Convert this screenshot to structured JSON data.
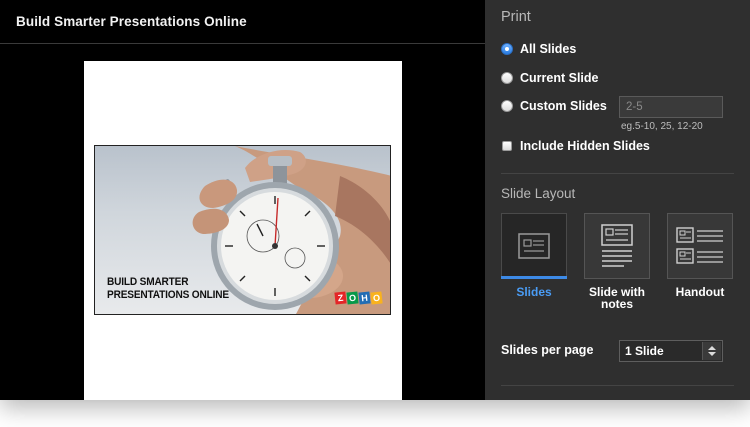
{
  "preview": {
    "title": "Build Smarter Presentations Online",
    "slide_caption_line1": "BUILD SMARTER",
    "slide_caption_line2": "PRESENTATIONS ONLINE",
    "logo_letters": [
      "Z",
      "O",
      "H",
      "O"
    ],
    "logo_colors": [
      "#e42527",
      "#089949",
      "#226db4",
      "#f9b21d"
    ]
  },
  "print": {
    "title": "Print",
    "options": [
      {
        "label": "All Slides",
        "checked": true
      },
      {
        "label": "Current Slide",
        "checked": false
      },
      {
        "label": "Custom Slides",
        "checked": false
      }
    ],
    "custom_placeholder": "2-5",
    "custom_hint": "eg.5-10, 25, 12-20",
    "include_hidden_label": "Include Hidden Slides"
  },
  "layout": {
    "title": "Slide Layout",
    "options": [
      {
        "label": "Slides",
        "selected": true,
        "icon": "slides-layout-icon"
      },
      {
        "label": "Slide with notes",
        "selected": false,
        "icon": "slide-notes-layout-icon"
      },
      {
        "label": "Handout",
        "selected": false,
        "icon": "handout-layout-icon"
      }
    ]
  },
  "per_page": {
    "label": "Slides per page",
    "value": "1 Slide"
  },
  "colors": {
    "accent": "#3d8ae6",
    "panel_bg": "#2f2f2f",
    "preview_bg": "#000000"
  }
}
